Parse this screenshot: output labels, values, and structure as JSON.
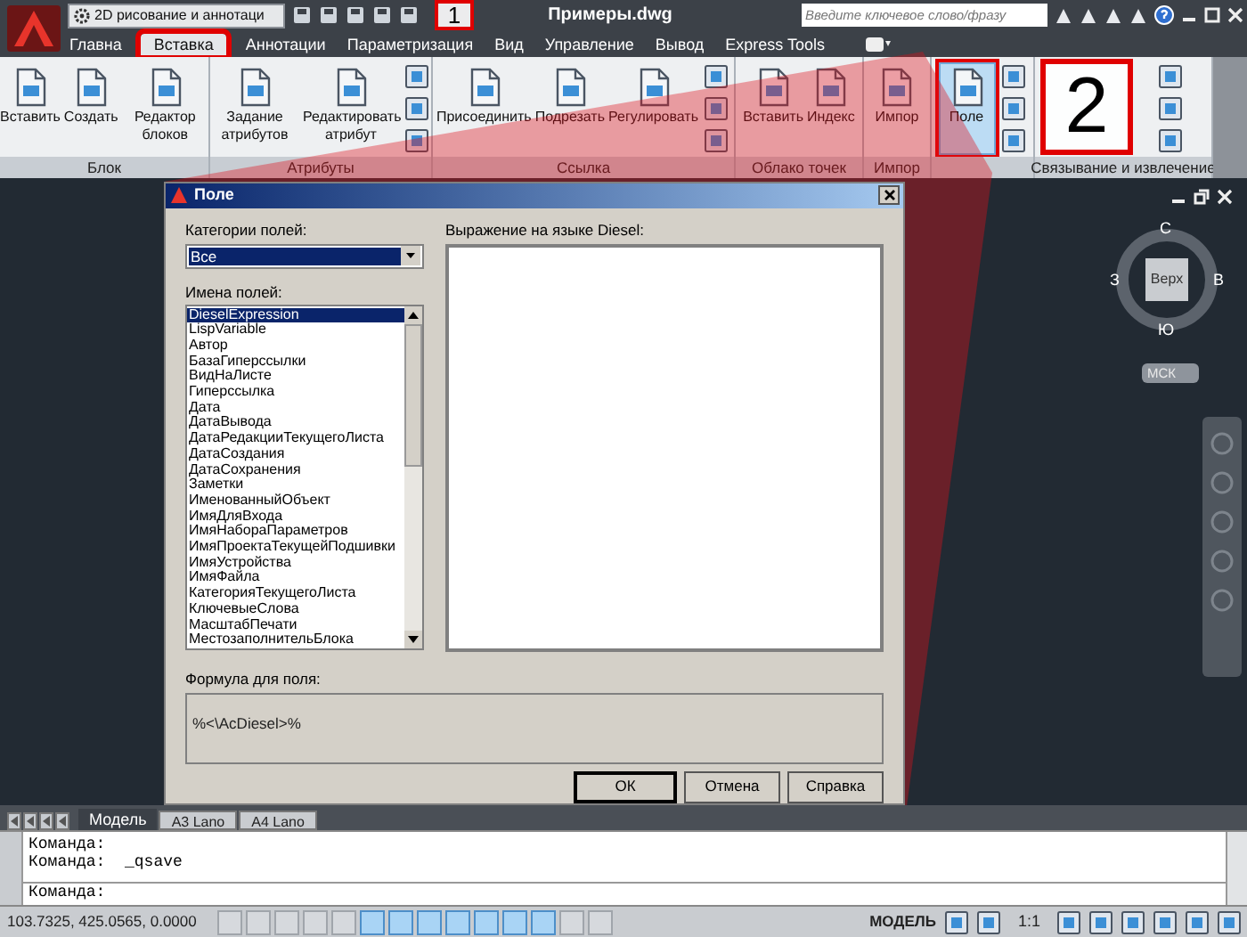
{
  "title_bar": {
    "workspace": "2D рисование и аннотаци",
    "document_title": "Примеры.dwg",
    "search": {
      "placeholder": "Введите ключевое слово/фразу"
    }
  },
  "tabs": [
    {
      "label": "Главна",
      "selected": false
    },
    {
      "label": "Вставка",
      "selected": true
    },
    {
      "label": "Аннотации",
      "selected": false
    },
    {
      "label": "Параметризация",
      "selected": false
    },
    {
      "label": "Вид",
      "selected": false
    },
    {
      "label": "Управление",
      "selected": false
    },
    {
      "label": "Вывод",
      "selected": false
    },
    {
      "label": "Express Tools",
      "selected": false
    }
  ],
  "ribbon_panels": [
    {
      "title": "Блок",
      "items": [
        {
          "kind": "large",
          "label": "Вставить",
          "selected": false
        },
        {
          "kind": "large",
          "label": "Создать",
          "selected": false
        },
        {
          "kind": "large",
          "label": "Редактор блоков",
          "selected": false
        }
      ]
    },
    {
      "title": "Атрибуты",
      "items": [
        {
          "kind": "large",
          "label": "Задание атрибутов",
          "selected": false
        },
        {
          "kind": "large",
          "label": "Редактировать атрибут",
          "selected": false
        },
        {
          "kind": "small"
        }
      ]
    },
    {
      "title": "Ссылка",
      "items": [
        {
          "kind": "large",
          "label": "Присоединить",
          "selected": false
        },
        {
          "kind": "large",
          "label": "Подрезать",
          "selected": false
        },
        {
          "kind": "large",
          "label": "Регулировать",
          "selected": false
        },
        {
          "kind": "small"
        }
      ]
    },
    {
      "title": "Облако точек",
      "items": [
        {
          "kind": "large",
          "label": "Вставить",
          "selected": false
        },
        {
          "kind": "large",
          "label": "Индекс",
          "selected": false
        }
      ]
    },
    {
      "title": "Импор",
      "items": [
        {
          "kind": "large",
          "label": "Импор",
          "selected": false
        }
      ]
    },
    {
      "items": [
        {
          "kind": "large",
          "label": "Поле",
          "selected": true
        },
        {
          "kind": "small"
        }
      ]
    },
    {
      "title": "Связывание и извлечение",
      "items": [
        {
          "kind": "blank"
        },
        {
          "kind": "small"
        }
      ]
    }
  ],
  "callouts": [
    {
      "number": "1"
    },
    {
      "number": "2"
    }
  ],
  "dialog": {
    "title": "Поле",
    "categories_label": "Категории полей:",
    "category": "Все",
    "names_label": "Имена полей:",
    "field_names": [
      {
        "label": "DieselExpression",
        "selected": true
      },
      {
        "label": "LispVariable",
        "selected": false
      },
      {
        "label": "Автор",
        "selected": false
      },
      {
        "label": "БазаГиперссылки",
        "selected": false
      },
      {
        "label": "ВидНаЛисте",
        "selected": false
      },
      {
        "label": "Гиперссылка",
        "selected": false
      },
      {
        "label": "Дата",
        "selected": false
      },
      {
        "label": "ДатаВывода",
        "selected": false
      },
      {
        "label": "ДатаРедакцииТекущегоЛиста",
        "selected": false
      },
      {
        "label": "ДатаСоздания",
        "selected": false
      },
      {
        "label": "ДатаСохранения",
        "selected": false
      },
      {
        "label": "Заметки",
        "selected": false
      },
      {
        "label": "ИменованныйОбъект",
        "selected": false
      },
      {
        "label": "ИмяДляВхода",
        "selected": false
      },
      {
        "label": "ИмяНабораПараметров",
        "selected": false
      },
      {
        "label": "ИмяПроектаТекущейПодшивки",
        "selected": false
      },
      {
        "label": "ИмяУстройства",
        "selected": false
      },
      {
        "label": "ИмяФайла",
        "selected": false
      },
      {
        "label": "КатегорияТекущегоЛиста",
        "selected": false
      },
      {
        "label": "КлючевыеСлова",
        "selected": false
      },
      {
        "label": "МасштабПечати",
        "selected": false
      },
      {
        "label": "МестозаполнительБлока",
        "selected": false
      }
    ],
    "expression_label": "Выражение на языке Diesel:",
    "formula_label": "Формула для поля:",
    "formula": "%<\\AcDiesel>%",
    "buttons": [
      {
        "label": "ОК",
        "default": true
      },
      {
        "label": "Отмена",
        "default": false
      },
      {
        "label": "Справка",
        "default": false
      }
    ]
  },
  "viewcube": {
    "north": "С",
    "south": "Ю",
    "west": "З",
    "east": "В",
    "face": "Верх",
    "ucs": "МСК"
  },
  "layout_tabs": [
    {
      "label": "Модель",
      "selected": true
    },
    {
      "label": "A3 Lano",
      "selected": false
    },
    {
      "label": "A4 Lano",
      "selected": false
    }
  ],
  "command_line": {
    "history": [
      "Команда:",
      "Команда:  _qsave"
    ],
    "prompt": "Команда:"
  },
  "status_bar": {
    "coordinates": "103.7325, 425.0565, 0.0000",
    "toggles": [
      {
        "on": false
      },
      {
        "on": false
      },
      {
        "on": false
      },
      {
        "on": false
      },
      {
        "on": false
      },
      {
        "on": true
      },
      {
        "on": true
      },
      {
        "on": true
      },
      {
        "on": true
      },
      {
        "on": true
      },
      {
        "on": true
      },
      {
        "on": true
      },
      {
        "on": false
      },
      {
        "on": false
      }
    ],
    "space": "МОДЕЛЬ",
    "scale": "1:1"
  }
}
